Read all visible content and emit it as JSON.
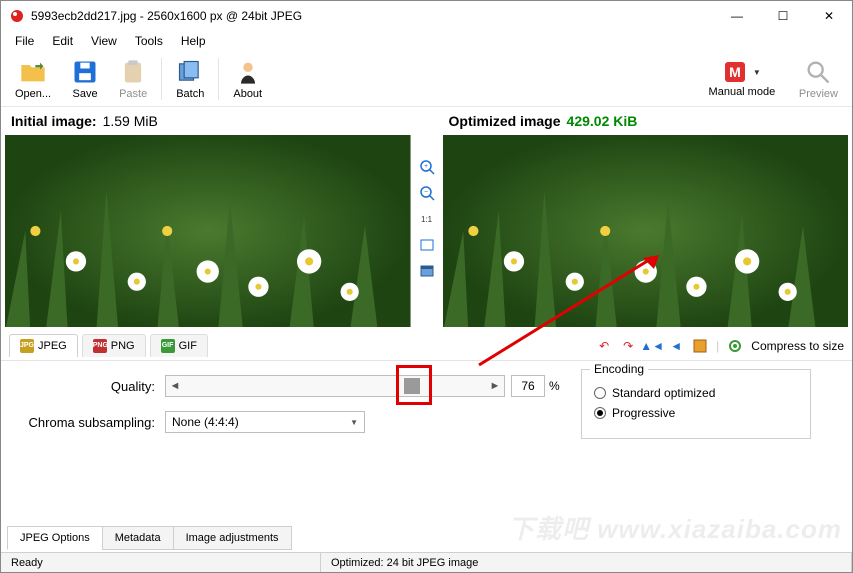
{
  "window": {
    "title": "5993ecb2dd217.jpg - 2560x1600 px @ 24bit JPEG",
    "min": "—",
    "max": "☐",
    "close": "✕"
  },
  "menu": {
    "file": "File",
    "edit": "Edit",
    "view": "View",
    "tools": "Tools",
    "help": "Help"
  },
  "toolbar": {
    "open": "Open...",
    "save": "Save",
    "paste": "Paste",
    "batch": "Batch",
    "about": "About",
    "manual": "Manual mode",
    "preview": "Preview"
  },
  "panels": {
    "initial_label": "Initial image:",
    "initial_size": "1.59 MiB",
    "optimized_label": "Optimized image",
    "optimized_size": "429.02 KiB"
  },
  "midtools": {
    "zoomin": "+",
    "zoomout": "−",
    "fit": "1:1"
  },
  "format_tabs": {
    "jpeg": "JPEG",
    "png": "PNG",
    "gif": "GIF"
  },
  "right_tools": {
    "compress": "Compress to size"
  },
  "options": {
    "quality_label": "Quality:",
    "quality_value": "76",
    "percent": "%",
    "chroma_label": "Chroma subsampling:",
    "chroma_value": "None (4:4:4)",
    "encoding_label": "Encoding",
    "radio_standard": "Standard optimized",
    "radio_progressive": "Progressive"
  },
  "bottom_tabs": {
    "jpeg_options": "JPEG Options",
    "metadata": "Metadata",
    "adjust": "Image adjustments"
  },
  "status": {
    "ready": "Ready",
    "optimized": "Optimized: 24 bit JPEG image"
  },
  "watermark": "下载吧 www.xiazaiba.com"
}
